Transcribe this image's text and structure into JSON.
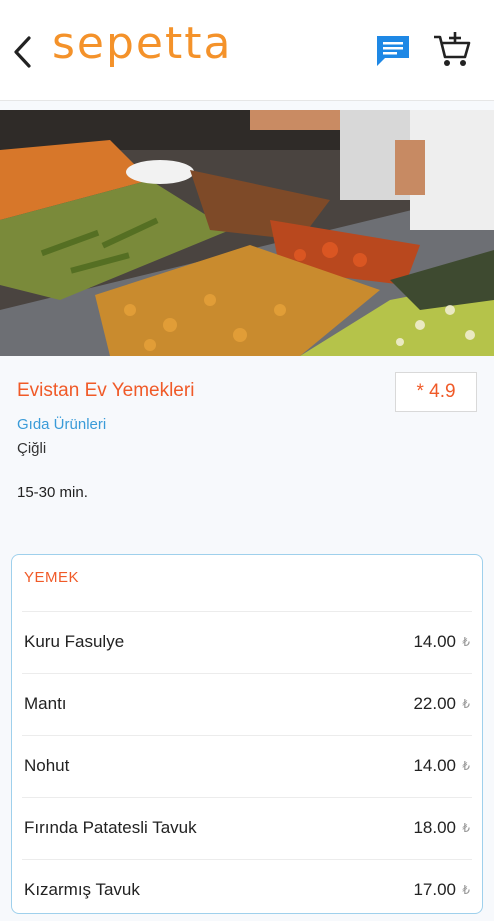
{
  "header": {
    "logo_text": "sepetta",
    "icons": {
      "back": "back-arrow-icon",
      "chat": "chat-icon",
      "cart": "add-to-cart-icon"
    },
    "colors": {
      "logo": "#f4922a",
      "chat": "#1e88e5"
    }
  },
  "hero": {
    "alt": "restaurant-food-display-image"
  },
  "restaurant": {
    "name": "Evistan Ev Yemekleri",
    "rating": "* 4.9",
    "category": "Gıda Ürünleri",
    "district": "Çiğli",
    "delivery_time": "15-30 min."
  },
  "menu": {
    "section_title": "YEMEK",
    "currency_symbol": "₺",
    "items": [
      {
        "name": "Kuru Fasulye",
        "price": "14.00"
      },
      {
        "name": "Mantı",
        "price": "22.00"
      },
      {
        "name": "Nohut",
        "price": "14.00"
      },
      {
        "name": "Fırında Patatesli Tavuk",
        "price": "18.00"
      },
      {
        "name": "Kızarmış Tavuk",
        "price": "17.00"
      }
    ]
  },
  "colors": {
    "accent": "#f05a28",
    "link": "#3a9bd8",
    "card_border": "#9fd0ec"
  }
}
